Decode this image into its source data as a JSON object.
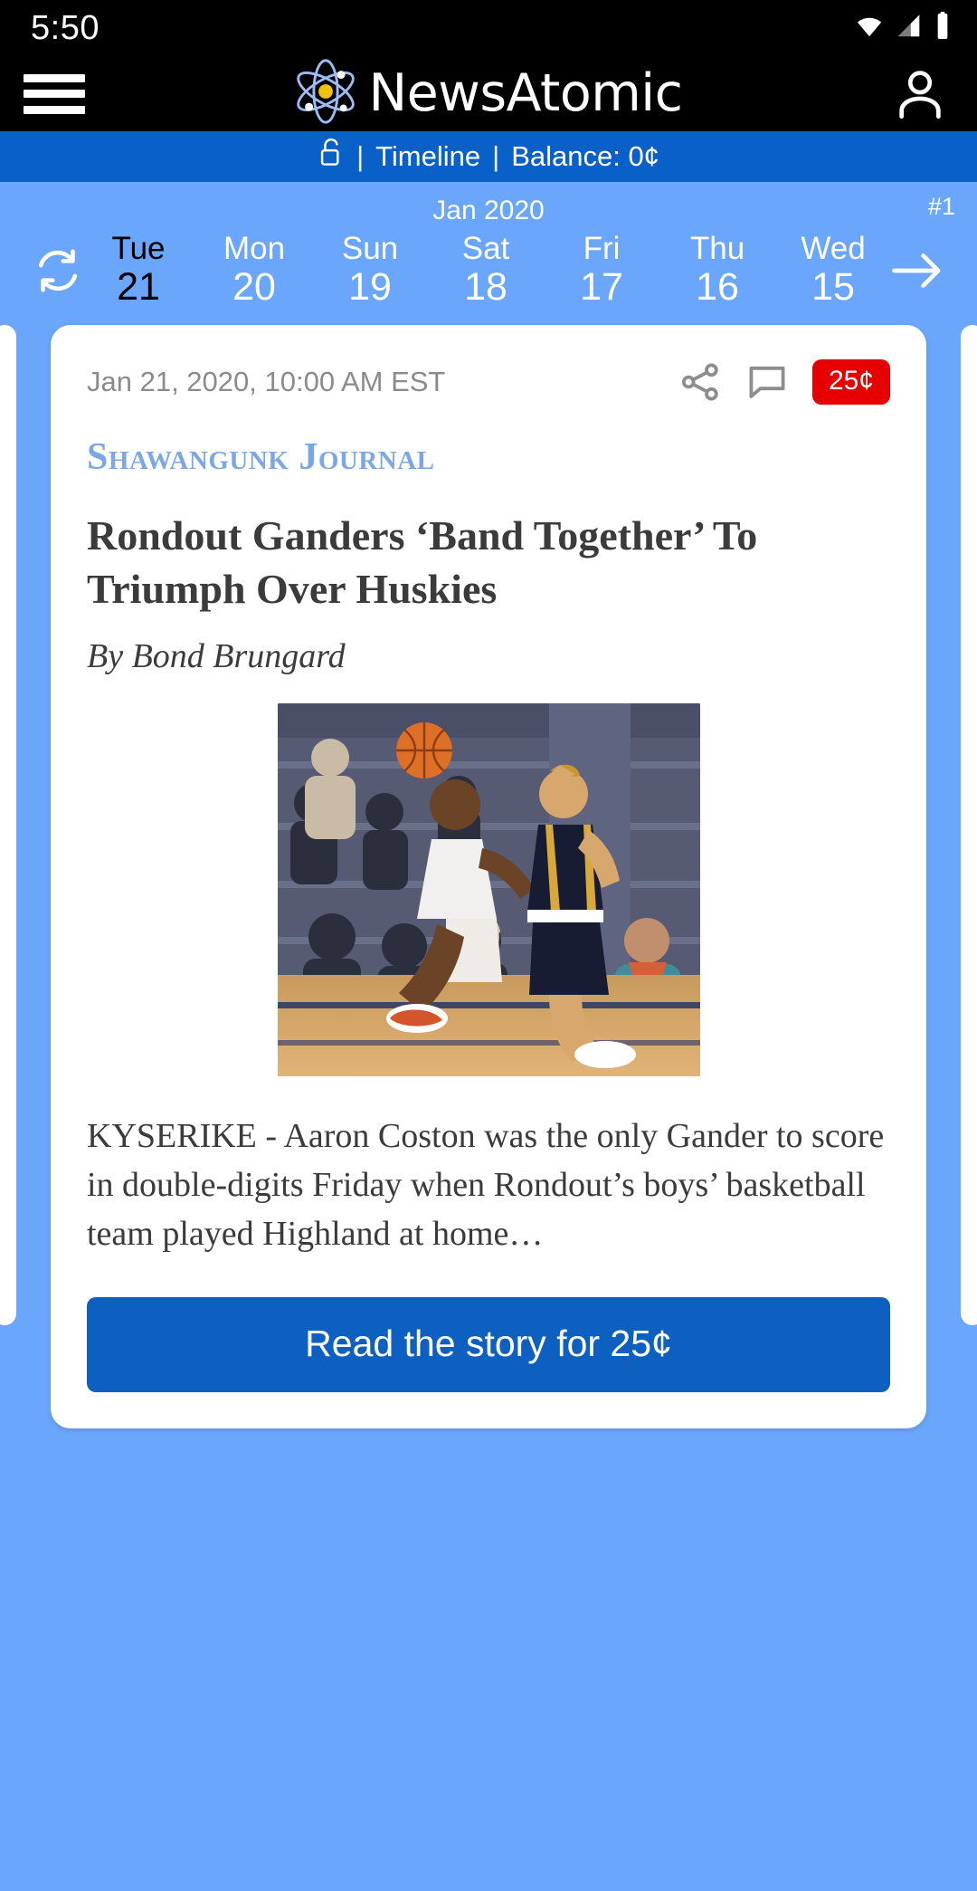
{
  "status_bar": {
    "time": "5:50",
    "icons": [
      "wifi-icon",
      "cell-signal-icon",
      "battery-icon"
    ]
  },
  "header": {
    "menu_icon": "hamburger-menu-icon",
    "logo_icon": "atom-icon",
    "title": "NewsAtomic",
    "account_icon": "user-account-icon"
  },
  "info_bar": {
    "lock_icon": "unlock-icon",
    "sep1": "|",
    "timeline_label": "Timeline",
    "sep2": "|",
    "balance_label": "Balance: 0¢"
  },
  "date_nav": {
    "month": "Jan 2020",
    "issue": "#1",
    "refresh_icon": "refresh-icon",
    "next_icon": "arrow-right-icon",
    "days": [
      {
        "dow": "Tue",
        "num": "21",
        "selected": true
      },
      {
        "dow": "Mon",
        "num": "20",
        "selected": false
      },
      {
        "dow": "Sun",
        "num": "19",
        "selected": false
      },
      {
        "dow": "Sat",
        "num": "18",
        "selected": false
      },
      {
        "dow": "Fri",
        "num": "17",
        "selected": false
      },
      {
        "dow": "Thu",
        "num": "16",
        "selected": false
      },
      {
        "dow": "Wed",
        "num": "15",
        "selected": false
      }
    ]
  },
  "article": {
    "timestamp": "Jan 21, 2020, 10:00 AM EST",
    "share_icon": "share-icon",
    "comment_icon": "comment-bubble-icon",
    "price_badge": "25¢",
    "publisher": "Shawangunk Journal",
    "headline": "Rondout Ganders ‘Band Together’ To Triumph Over Huskies",
    "byline": "By Bond Brungard",
    "photo_alt": "basketball-game-photo",
    "excerpt": "KYSERIKE - Aaron Coston was the only Gander to score in double-digits Friday when Rondout’s boys’ basketball team played Highland at home…",
    "cta_label": "Read the story for 25¢"
  },
  "colors": {
    "accent_blue": "#0a60c9",
    "page_blue": "#6aa6fb",
    "cta_blue": "#0d5fc0",
    "price_red": "#e60000",
    "publisher_blue": "#7ba7e8"
  }
}
